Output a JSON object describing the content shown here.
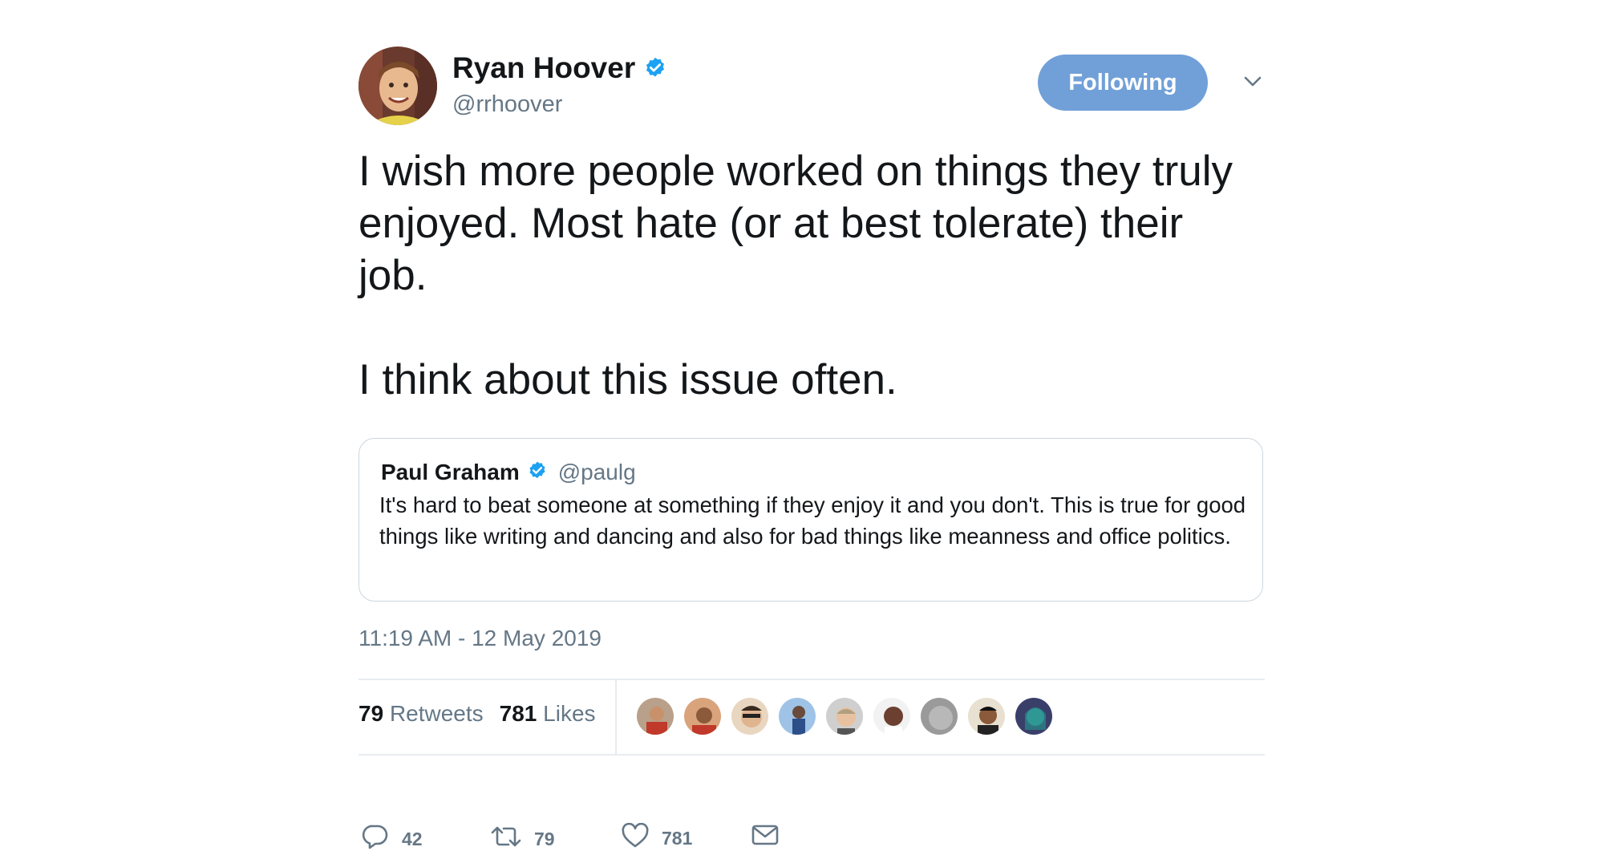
{
  "author": {
    "name": "Ryan Hoover",
    "handle": "@rrhoover",
    "verified": true
  },
  "follow_button": {
    "label": "Following",
    "color": "#71a0d8"
  },
  "tweet": {
    "paragraphs": [
      "I wish more people worked on things they truly enjoyed. Most hate (or at best tolerate) their job.",
      "I think about this issue often."
    ],
    "timestamp": "11:19 AM - 12 May 2019"
  },
  "quoted_tweet": {
    "name": "Paul Graham",
    "handle": "@paulg",
    "verified": true,
    "text": "It's hard to beat someone at something if they enjoy it and you don't. This is true for good things like writing and dancing and also for bad things like meanness and office politics."
  },
  "stats": {
    "retweets": {
      "count": "79",
      "label": "Retweets"
    },
    "likes": {
      "count": "781",
      "label": "Likes"
    }
  },
  "actions": {
    "reply": {
      "icon": "reply-icon",
      "count": "42"
    },
    "retweet": {
      "icon": "retweet-icon",
      "count": "79"
    },
    "like": {
      "icon": "heart-icon",
      "count": "781"
    },
    "dm": {
      "icon": "envelope-icon"
    }
  },
  "colors": {
    "verified": "#1da1f2",
    "secondary_text": "#657786",
    "border": "#ccd6dd"
  }
}
